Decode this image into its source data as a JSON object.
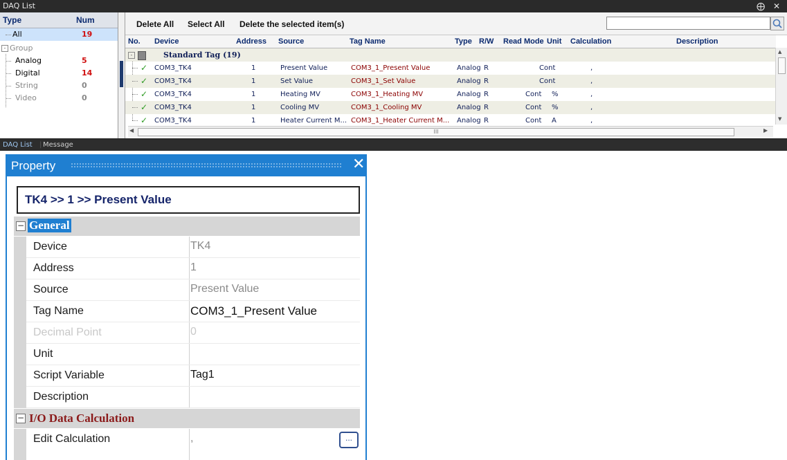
{
  "daq": {
    "title": "DAQ List",
    "window_controls": "⨁ ✕",
    "type_header": "Type",
    "num_header": "Num",
    "types": [
      {
        "name": "All",
        "num": "19"
      },
      {
        "name": "Group",
        "num": ""
      },
      {
        "name": "Analog",
        "num": "5"
      },
      {
        "name": "Digital",
        "num": "14"
      },
      {
        "name": "String",
        "num": "0"
      },
      {
        "name": "Video",
        "num": "0"
      }
    ],
    "toolbar": {
      "delete_all": "Delete All",
      "select_all": "Select All",
      "delete_selected": "Delete the selected item(s)",
      "search_value": ""
    },
    "columns": [
      "No.",
      "Device",
      "Address",
      "Source",
      "Tag Name",
      "Type",
      "R/W",
      "Read Mode",
      "Unit",
      "Calculation",
      "Description"
    ],
    "group_label": "Standard Tag (19)",
    "rows": [
      {
        "device": "COM3_TK4",
        "address": "1",
        "source": "Present Value",
        "tag": "COM3_1_Present Value",
        "type": "Analog",
        "rw": "R",
        "mode": "Cont",
        "unit": "",
        "calc": ","
      },
      {
        "device": "COM3_TK4",
        "address": "1",
        "source": "Set Value",
        "tag": "COM3_1_Set Value",
        "type": "Analog",
        "rw": "R",
        "mode": "Cont",
        "unit": "",
        "calc": ","
      },
      {
        "device": "COM3_TK4",
        "address": "1",
        "source": "Heating MV",
        "tag": "COM3_1_Heating MV",
        "type": "Analog",
        "rw": "R",
        "mode": "Cont",
        "unit": "%",
        "calc": ","
      },
      {
        "device": "COM3_TK4",
        "address": "1",
        "source": "Cooling MV",
        "tag": "COM3_1_Cooling MV",
        "type": "Analog",
        "rw": "R",
        "mode": "Cont",
        "unit": "%",
        "calc": ","
      },
      {
        "device": "COM3_TK4",
        "address": "1",
        "source": "Heater Current M...",
        "tag": "COM3_1_Heater Current M...",
        "type": "Analog",
        "rw": "R",
        "mode": "Cont",
        "unit": "A",
        "calc": ","
      }
    ],
    "hscroll_grip": "III",
    "tabs": [
      "DAQ List",
      "Message"
    ]
  },
  "property": {
    "title": "Property",
    "close": "✕",
    "breadcrumb": "TK4 >> 1 >> Present Value",
    "sections": {
      "general": "General",
      "io": "I/O Data Calculation"
    },
    "fields": [
      {
        "label": "Device",
        "value": "TK4"
      },
      {
        "label": "Address",
        "value": "1"
      },
      {
        "label": "Source",
        "value": "Present Value"
      },
      {
        "label": "Tag Name",
        "value": "COM3_1_Present Value"
      },
      {
        "label": "Decimal Point",
        "value": "0"
      },
      {
        "label": "Unit",
        "value": ""
      },
      {
        "label": "Script Variable",
        "value": "Tag1"
      },
      {
        "label": "Description",
        "value": ""
      }
    ],
    "calc": {
      "label": "Edit Calculation",
      "value": ",",
      "button": "..."
    }
  },
  "colors": {
    "accent": "#1f7fd1",
    "red_num": "#d01010",
    "header_text": "#0b2a6f",
    "check": "#2e9b23"
  }
}
